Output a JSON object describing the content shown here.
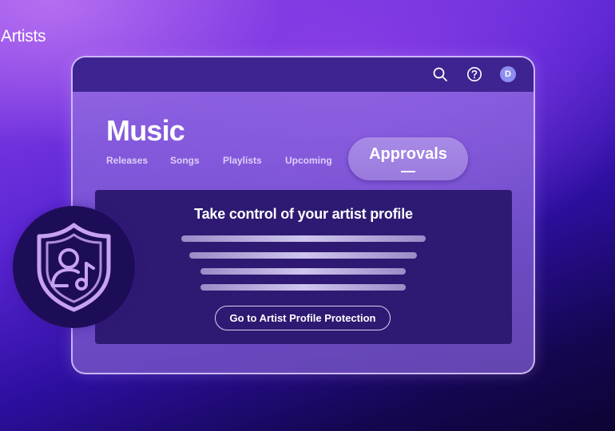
{
  "brand": {
    "label": "Artists"
  },
  "topbar": {
    "icons": [
      "search-icon",
      "help-icon"
    ],
    "avatar_initial": "D"
  },
  "page": {
    "title": "Music",
    "tabs": [
      {
        "label": "Releases",
        "active": false
      },
      {
        "label": "Songs",
        "active": false
      },
      {
        "label": "Playlists",
        "active": false
      },
      {
        "label": "Upcoming",
        "active": false
      },
      {
        "label": "Approvals",
        "active": true
      }
    ]
  },
  "panel": {
    "heading": "Take control of your artist profile",
    "cta_label": "Go to Artist Profile Protection"
  },
  "badge": {
    "icon": "shield-artist-music-icon"
  },
  "colors": {
    "window_bg": "#8a68d6",
    "topbar_bg": "#3e2490",
    "panel_bg": "#2e1a72",
    "avatar_bg": "#8e8ef0",
    "badge_bg": "#1d0d58",
    "badge_stroke": "#c8a2f2"
  }
}
